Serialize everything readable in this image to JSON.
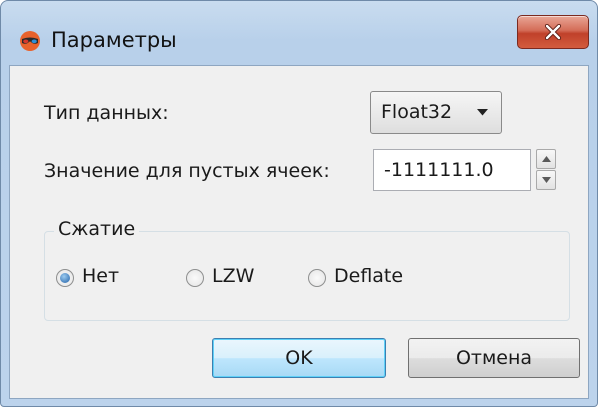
{
  "window": {
    "title": "Параметры",
    "icon": "app-3d-glasses-icon",
    "close_icon": "close-icon"
  },
  "form": {
    "data_type_label": "Тип данных:",
    "data_type_value": "Float32",
    "nodata_label": "Значение для пустых ячеек:",
    "nodata_value": "-1111111.0"
  },
  "compression": {
    "group_label": "Сжатие",
    "options": [
      {
        "label": "Нет",
        "selected": true
      },
      {
        "label": "LZW",
        "selected": false
      },
      {
        "label": "Deflate",
        "selected": false
      }
    ]
  },
  "buttons": {
    "ok_label": "OK",
    "cancel_label": "Отмена"
  },
  "colors": {
    "title_bar": "#c4d9ef",
    "close_button": "#c8503a",
    "dialog_bg": "#f0f0f0",
    "default_button": "#bee6fd",
    "radio_selected": "#1f5fa6"
  }
}
